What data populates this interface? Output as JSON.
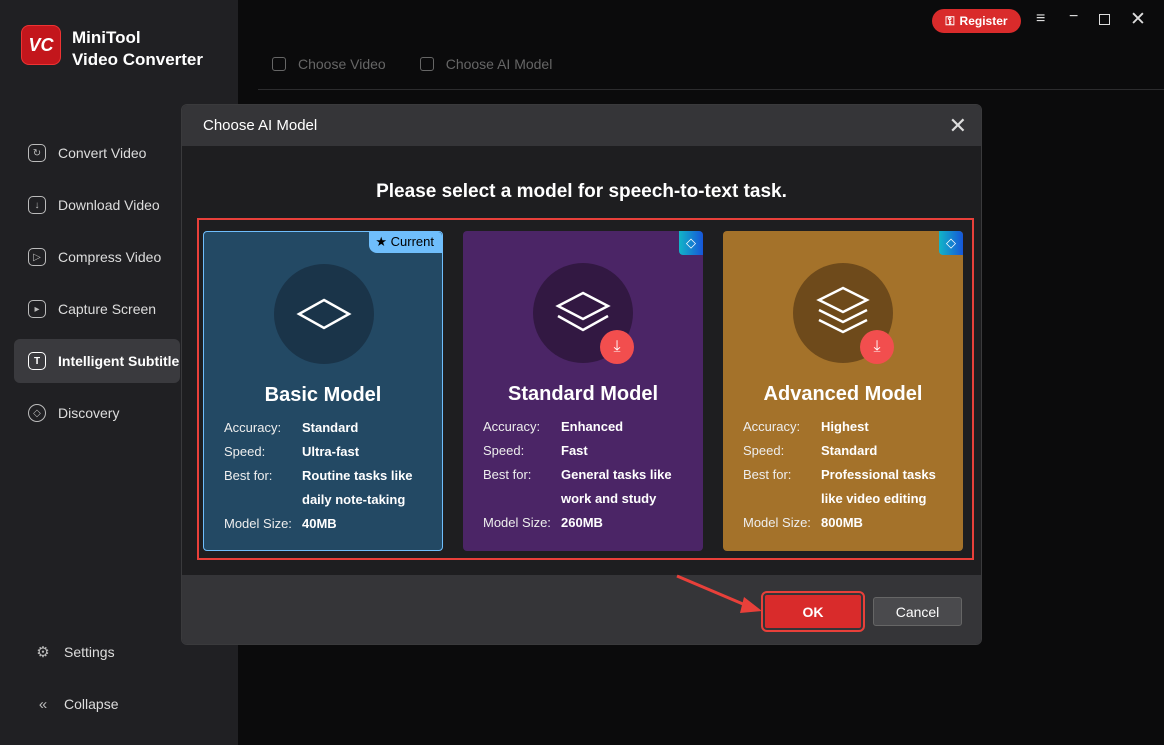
{
  "app": {
    "logo_text": "VC",
    "name_line1": "MiniTool",
    "name_line2": "Video Converter"
  },
  "sidebar": {
    "items": [
      {
        "label": "Convert Video"
      },
      {
        "label": "Download Video"
      },
      {
        "label": "Compress Video"
      },
      {
        "label": "Capture Screen"
      },
      {
        "label": "Intelligent Subtitle"
      },
      {
        "label": "Discovery"
      }
    ],
    "settings": "Settings",
    "collapse": "Collapse"
  },
  "topbar": {
    "register": "Register"
  },
  "tabs": [
    {
      "label": "Choose Video"
    },
    {
      "label": "Choose AI Model"
    }
  ],
  "dialog": {
    "title": "Choose AI Model",
    "heading": "Please select a model for speech-to-text task.",
    "labels": {
      "accuracy": "Accuracy:",
      "speed": "Speed:",
      "best_for": "Best for:",
      "size": "Model Size:"
    },
    "models": [
      {
        "name": "Basic Model",
        "accuracy": "Standard",
        "speed": "Ultra-fast",
        "best_for_1": "Routine tasks like",
        "best_for_2": "daily note-taking",
        "size": "40MB",
        "badge": "Current",
        "color": "#234964"
      },
      {
        "name": "Standard Model",
        "accuracy": "Enhanced",
        "speed": "Fast",
        "best_for_1": "General tasks like",
        "best_for_2": "work and study",
        "size": "260MB",
        "color": "#4b2566"
      },
      {
        "name": "Advanced Model",
        "accuracy": "Highest",
        "speed": "Standard",
        "best_for_1": "Professional tasks",
        "best_for_2": "like video editing",
        "size": "800MB",
        "color": "#a4722a"
      }
    ],
    "ok": "OK",
    "cancel": "Cancel"
  }
}
